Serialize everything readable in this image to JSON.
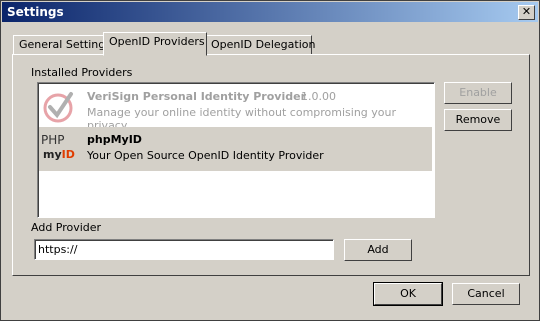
{
  "window": {
    "title": "Settings",
    "close_symbol": "✕"
  },
  "tabs": [
    {
      "label": "General Settings"
    },
    {
      "label": "OpenID Providers"
    },
    {
      "label": "OpenID Delegation"
    }
  ],
  "providers": {
    "section_label": "Installed Providers",
    "items": [
      {
        "name": "VeriSign Personal Identity Provider",
        "version": "1.0.00",
        "description": "Manage your online identity without compromising your privacy.",
        "icon": "verisign-check-icon",
        "disabled": true
      },
      {
        "name": "phpMyID",
        "description": "Your Open Source OpenID Identity Provider",
        "icon_text_top": "PHP",
        "icon_text_my": "my",
        "icon_text_id": "ID",
        "selected": true
      }
    ],
    "enable_label": "Enable",
    "remove_label": "Remove"
  },
  "add_provider": {
    "section_label": "Add Provider",
    "value": "https://",
    "add_label": "Add"
  },
  "footer": {
    "ok_label": "OK",
    "cancel_label": "Cancel"
  },
  "colors": {
    "titlebar": "#0a246a",
    "face": "#d4d0c8",
    "accent_red": "#e03c00"
  }
}
